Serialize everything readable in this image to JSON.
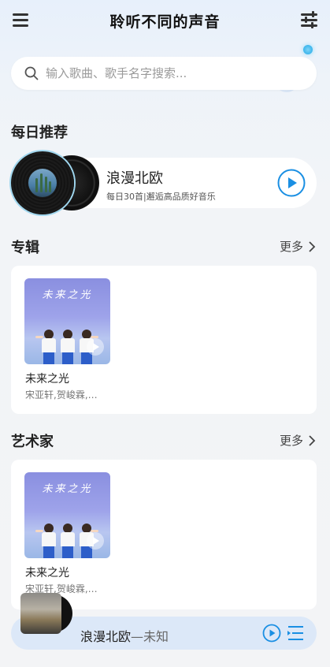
{
  "header": {
    "title": "聆听不同的声音"
  },
  "search": {
    "placeholder": "输入歌曲、歌手名字搜索..."
  },
  "daily": {
    "section_title": "每日推荐",
    "name": "浪漫北欧",
    "desc": "每日30首|邂逅高品质好音乐"
  },
  "albums": {
    "section_title": "专辑",
    "more_label": "更多",
    "items": [
      {
        "cover_title": "未来之光",
        "name": "未来之光",
        "artist": "宋亚轩,贺峻霖,…"
      }
    ]
  },
  "artists": {
    "section_title": "艺术家",
    "more_label": "更多",
    "items": [
      {
        "cover_title": "未来之光",
        "name": "未来之光",
        "artist": "宋亚轩,贺峻霖,…"
      }
    ]
  },
  "player": {
    "song": "浪漫北欧",
    "artist": "—未知"
  },
  "colors": {
    "accent": "#1a8fe3",
    "player_bg": "#dce8f8"
  }
}
